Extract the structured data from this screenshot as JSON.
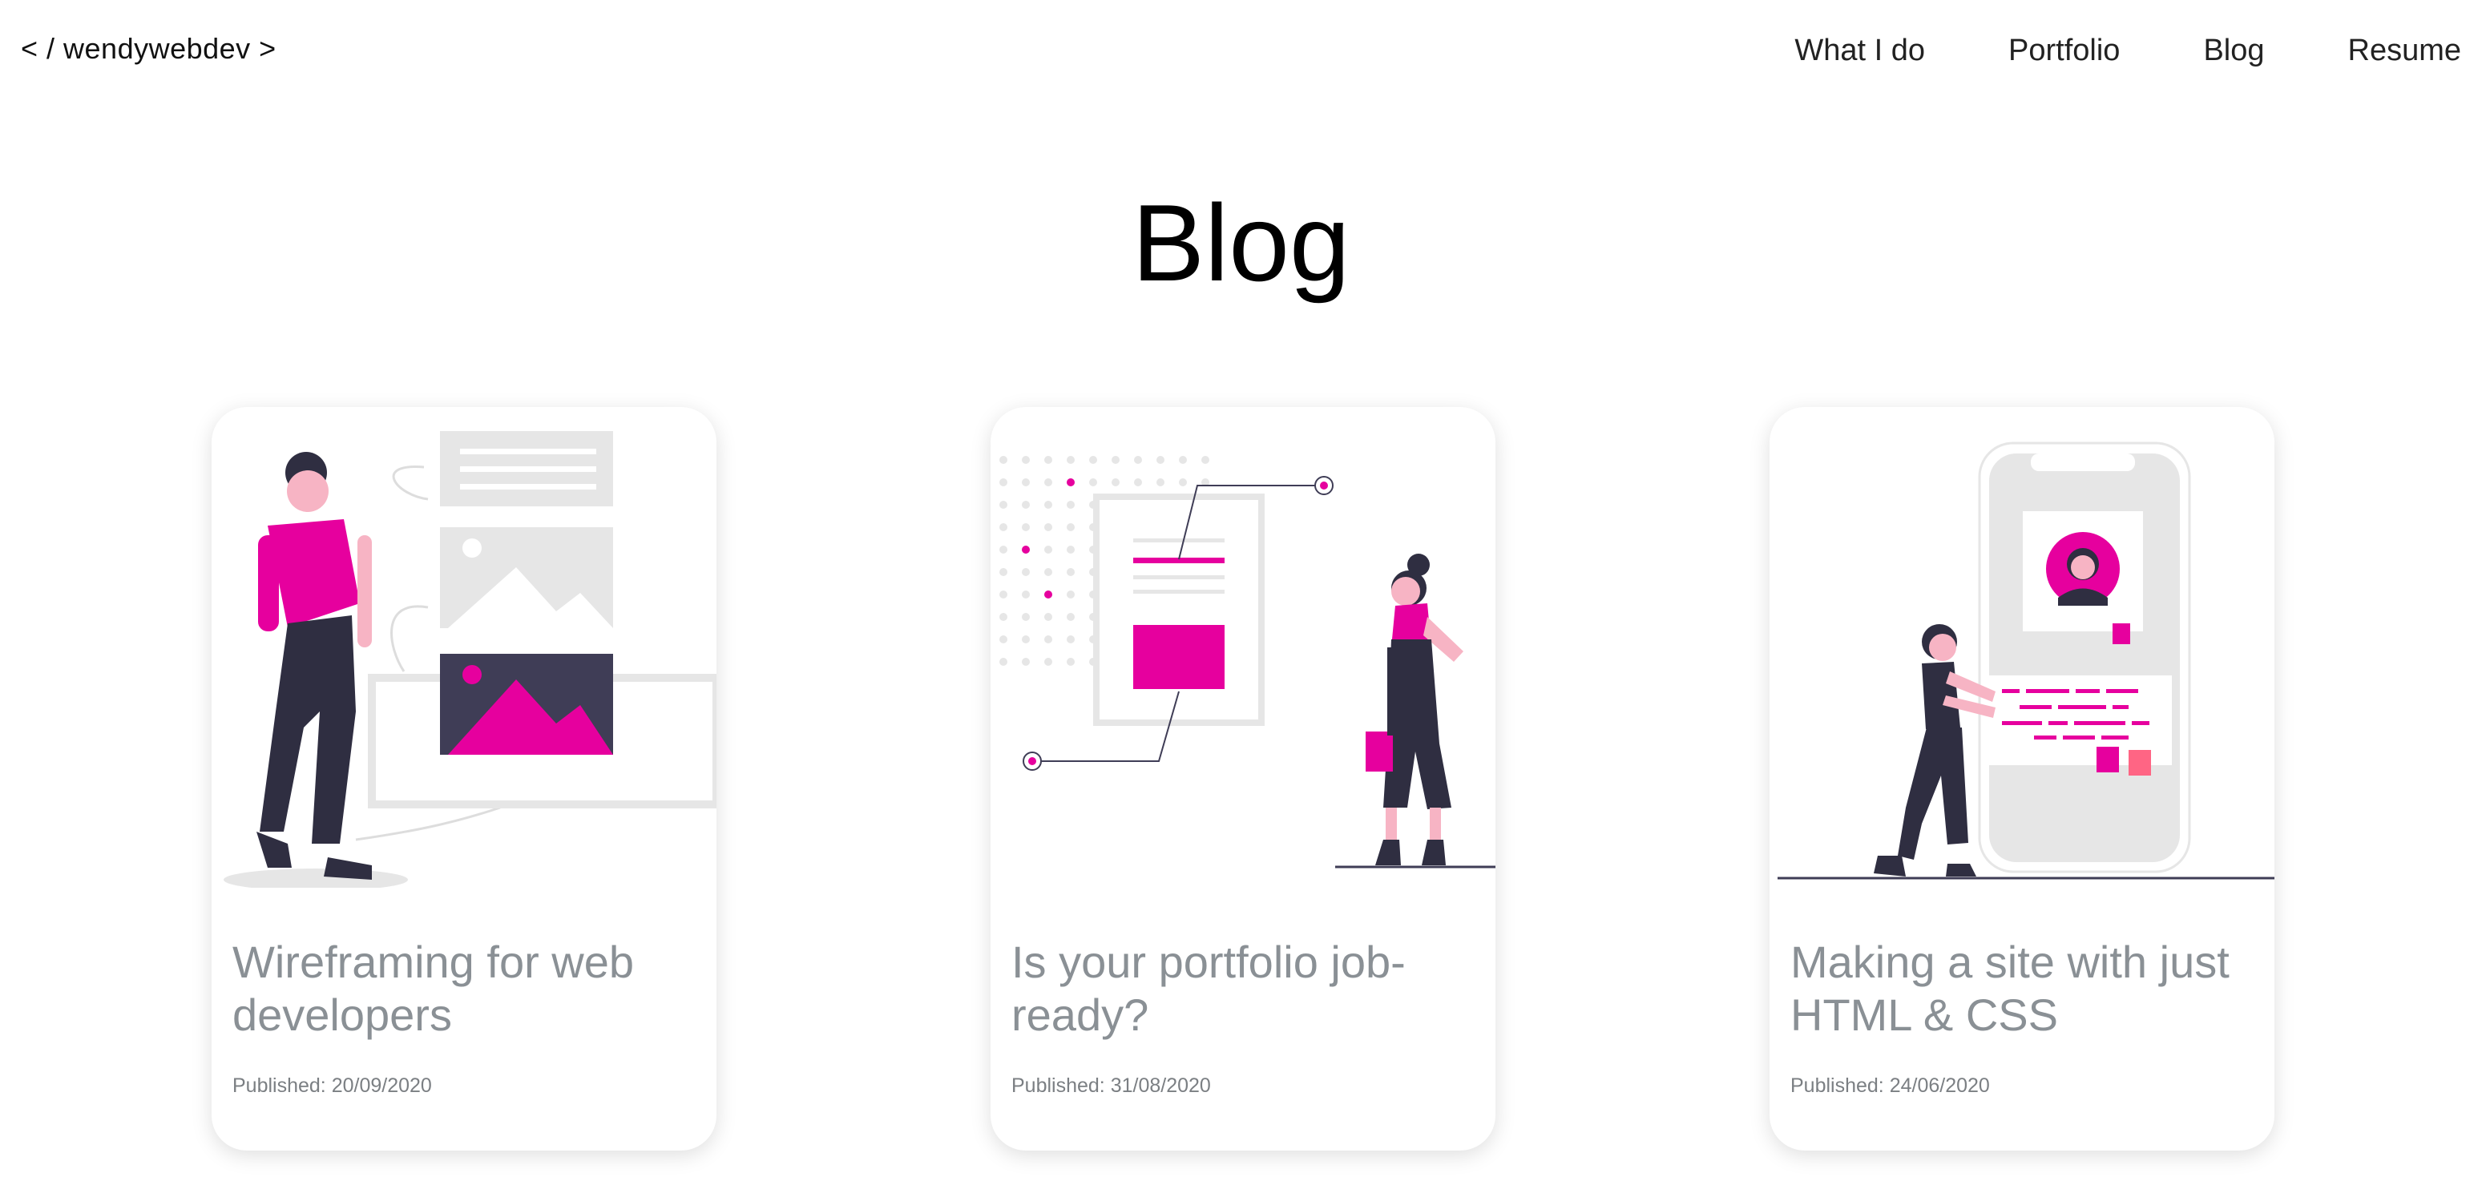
{
  "header": {
    "logo": "< / wendywebdev >",
    "nav": [
      "What I do",
      "Portfolio",
      "Blog",
      "Resume"
    ]
  },
  "page_title": "Blog",
  "posts": [
    {
      "title": "Wireframing for web developers",
      "date": "Published: 20/09/2020",
      "illustration": "wireframing-illustration"
    },
    {
      "title": "Is your portfolio job-ready?",
      "date": "Published: 31/08/2020",
      "illustration": "portfolio-illustration"
    },
    {
      "title": "Making a site with just HTML & CSS",
      "date": "Published: 24/06/2020",
      "illustration": "mobile-site-illustration"
    }
  ],
  "colors": {
    "accent": "#e6009e",
    "dark": "#2f2e41",
    "grey": "#e6e6e6",
    "text_muted": "#8a9095"
  }
}
